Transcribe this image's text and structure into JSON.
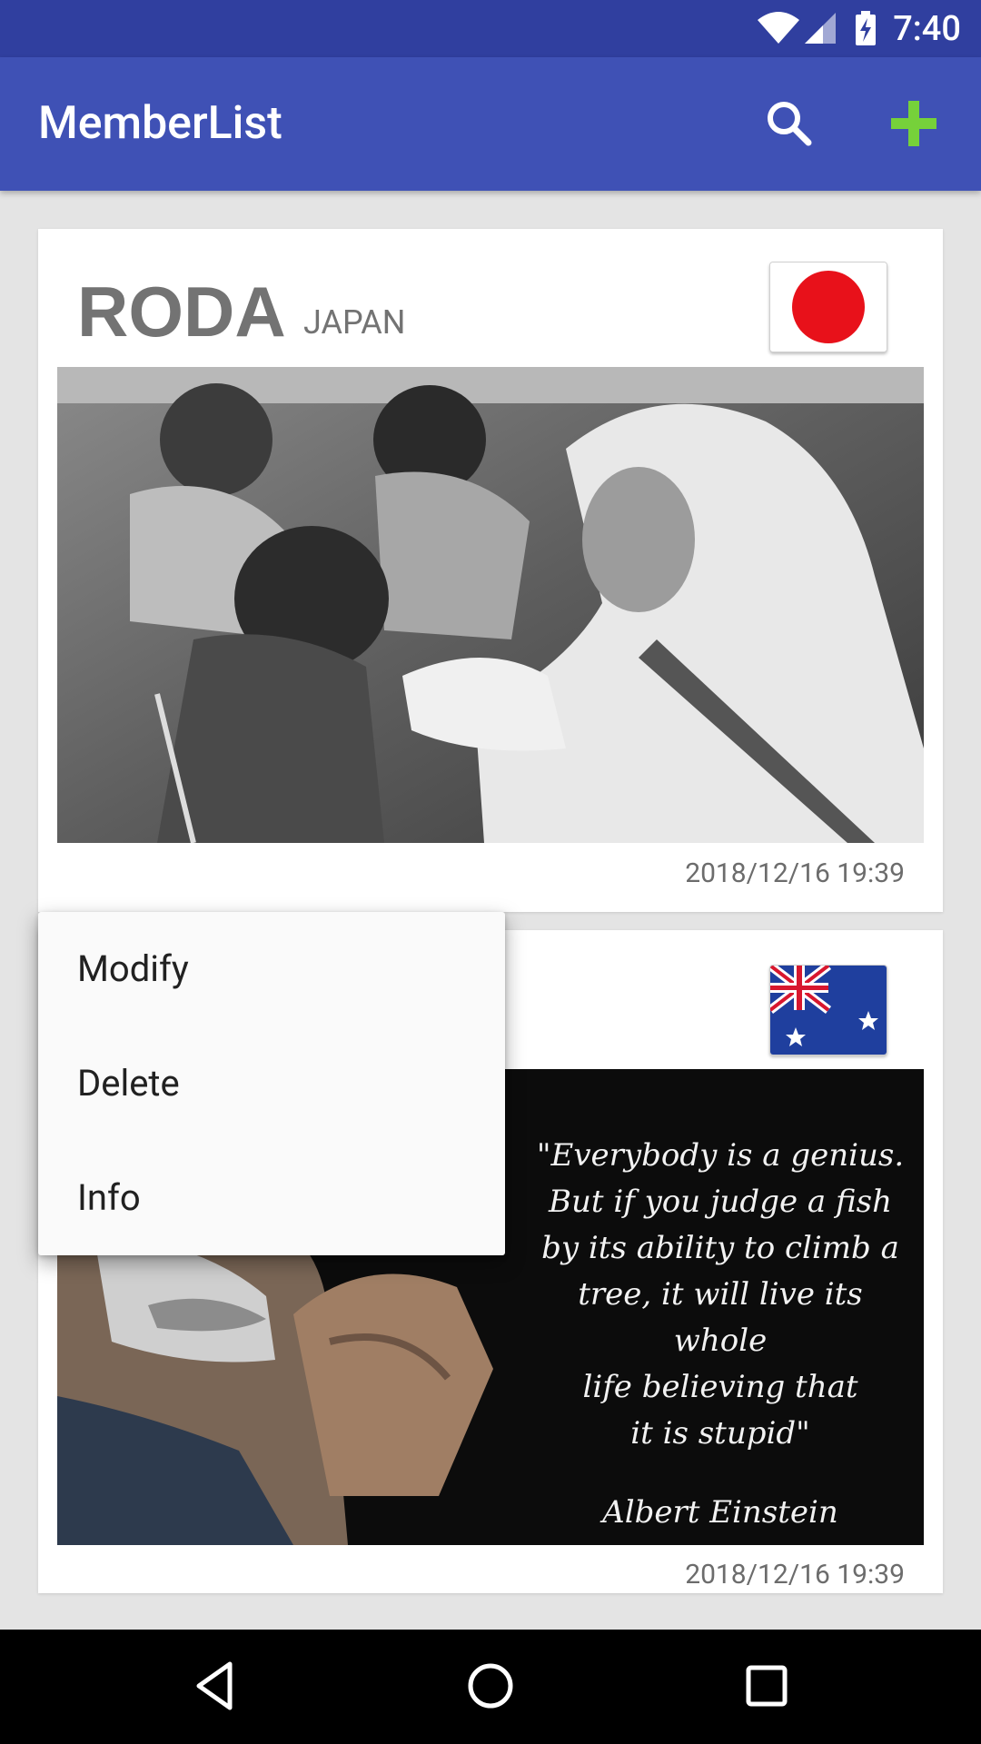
{
  "status_bar": {
    "time": "7:40"
  },
  "app_bar": {
    "title": "MemberList"
  },
  "members": [
    {
      "name": "RODA",
      "country": "JAPAN",
      "timestamp": "2018/12/16 19:39"
    },
    {
      "name": "",
      "country": "",
      "timestamp": "2018/12/16 19:39",
      "quote_lines": [
        "\"Everybody is a genius.",
        "But if you judge a fish",
        "by its ability to climb a",
        "tree, it will live its whole",
        "life believing that",
        "it is stupid\""
      ],
      "quote_author": "Albert Einstein"
    }
  ],
  "context_menu": {
    "items": [
      "Modify",
      "Delete",
      "Info"
    ]
  },
  "colors": {
    "status_bar": "#303f9f",
    "app_bar": "#3f51b5",
    "add_icon": "#76d13a"
  }
}
